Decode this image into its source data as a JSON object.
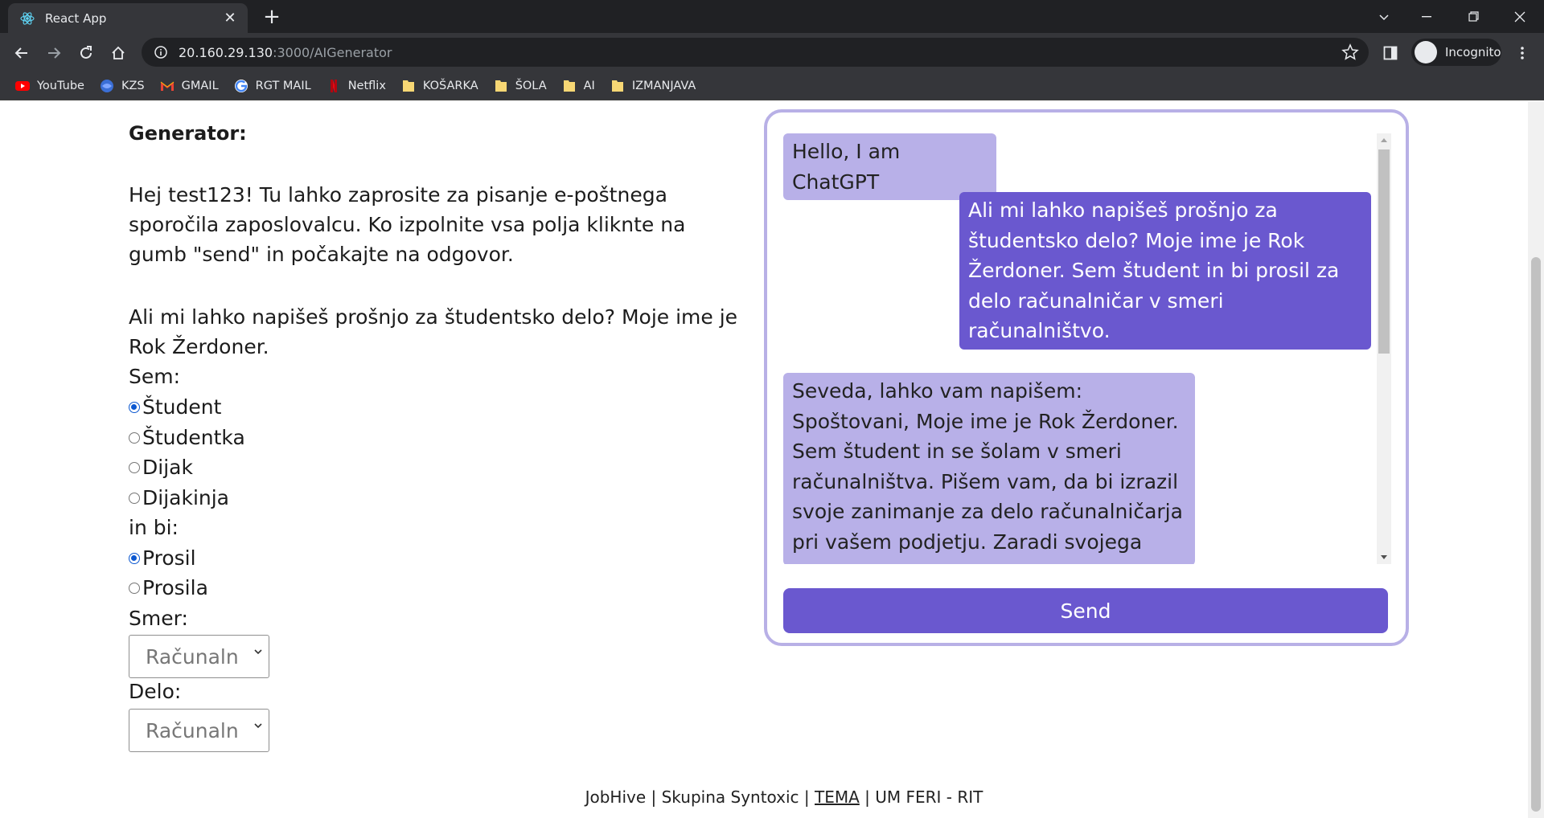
{
  "browser": {
    "tab_title": "React App",
    "url_host": "20.160.29.130",
    "url_rest": ":3000/AIGenerator",
    "profile_label": "Incognito",
    "bookmarks": [
      "YouTube",
      "KZS",
      "GMAIL",
      "RGT MAIL",
      "Netflix",
      "KOŠARKA",
      "ŠOLA",
      "AI",
      "IZMANJAVA"
    ]
  },
  "form": {
    "title": "Generator:",
    "intro": "Hej test123! Tu lahko zaprosite za pisanje e-poštnega sporočila zaposlovalcu. Ko izpolnite vsa polja kliknte na gumb \"send\" in počakajte na odgovor.",
    "prompt": "Ali mi lahko napišeš prošnjo za študentsko delo? Moje ime je Rok Žerdoner.",
    "sem_label": "Sem:",
    "sem_options": [
      "Študent",
      "Študentka",
      "Dijak",
      "Dijakinja"
    ],
    "sem_selected": "Študent",
    "inbi_label": "in bi:",
    "inbi_options": [
      "Prosil",
      "Prosila"
    ],
    "inbi_selected": "Prosil",
    "smer_label": "Smer:",
    "smer_value": "Računaln",
    "delo_label": "Delo:",
    "delo_value": "Računaln"
  },
  "chat": {
    "messages": [
      {
        "role": "bot",
        "text": "Hello, I am ChatGPT"
      },
      {
        "role": "user",
        "text": "Ali mi lahko napišeš prošnjo za študentsko delo? Moje ime je Rok Žerdoner. Sem študent in bi prosil za delo računalničar v smeri računalništvo."
      },
      {
        "role": "bot",
        "text": "Seveda, lahko vam napišem: Spoštovani, Moje ime je Rok Žerdoner. Sem študent in se šolam v smeri računalništva. Pišem vam, da bi izrazil svoje zanimanje za delo računalničarja pri vašem podjetju. Zaradi svojega"
      }
    ],
    "send_label": "Send"
  },
  "footer": {
    "part1": "JobHive | Skupina Syntoxic | ",
    "link": "TEMA",
    "part2": " | UM FERI - RIT"
  },
  "colors": {
    "accent": "#6a58cf",
    "bot_bubble": "#b8b0e8",
    "chat_border": "#b8b0e6"
  }
}
